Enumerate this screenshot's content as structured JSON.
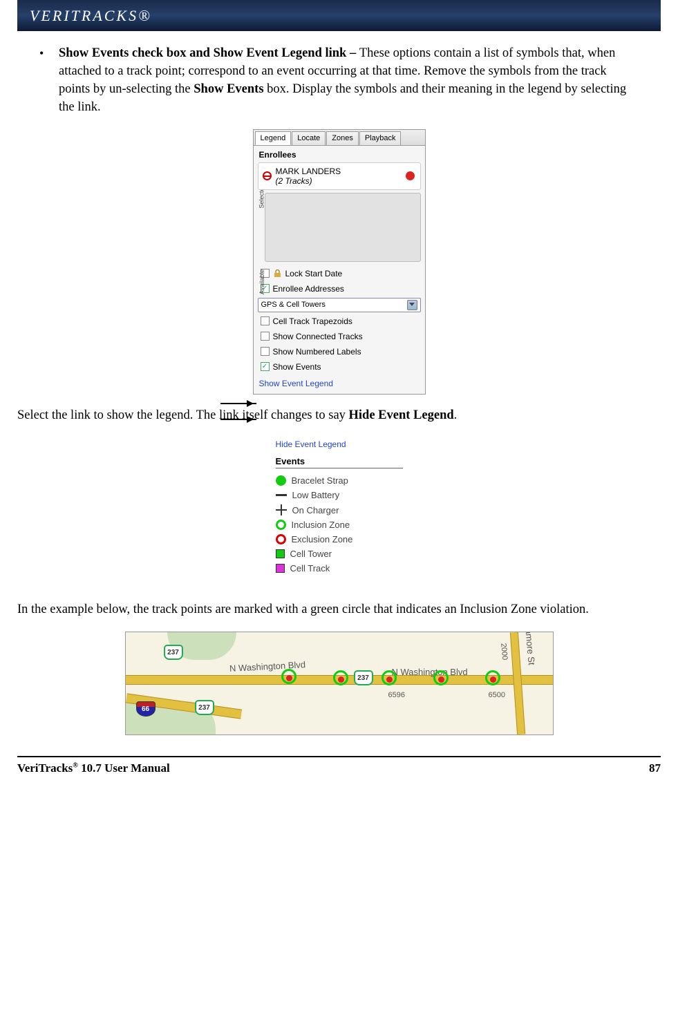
{
  "brand": "VERITRACKS®",
  "bullet": {
    "title": "Show Events check box and Show Event Legend link – ",
    "body1": "These options contain a list of symbols that, when attached to a track point; correspond to an event occurring at that time. Remove the symbols from the track points by un-selecting the ",
    "bold1": "Show Events",
    "body2": " box.  Display the symbols and their meaning in the legend by selecting the link."
  },
  "panel1": {
    "tabs": [
      "Legend",
      "Locate",
      "Zones",
      "Playback"
    ],
    "section": "Enrollees",
    "selected_name": "MARK LANDERS",
    "selected_sub": "(2 Tracks)",
    "side_selected": "Selected",
    "side_available": "Available",
    "rows": {
      "lock": "Lock Start Date",
      "addresses": "Enrollee Addresses",
      "select_value": "GPS & Cell Towers",
      "trapezoids": "Cell Track Trapezoids",
      "connected": "Show Connected Tracks",
      "numbered": "Show Numbered Labels",
      "events": "Show Events"
    },
    "link": "Show Event Legend"
  },
  "mid_text": {
    "t1": "Select the link to show the legend.  The link itself changes to say ",
    "b1": "Hide Event Legend",
    "t2": "."
  },
  "panel2": {
    "hide_link": "Hide Event Legend",
    "title": "Events",
    "items": [
      "Bracelet Strap",
      "Low Battery",
      "On Charger",
      "Inclusion Zone",
      "Exclusion Zone",
      "Cell Tower",
      "Cell Track"
    ]
  },
  "lower_text": "In the example below, the track points are marked with a green circle that indicates an Inclusion Zone violation.",
  "map": {
    "road_main": "N Washington Blvd",
    "road_main2": "N Washington Blvd",
    "side_road": "Sycamore St",
    "shield237": "237",
    "shield66": "66",
    "num6596": "6596",
    "num6500": "6500",
    "num2000": "2000"
  },
  "footer": {
    "left_a": "VeriTracks",
    "left_b": " 10.7 User Manual",
    "right": "87"
  }
}
